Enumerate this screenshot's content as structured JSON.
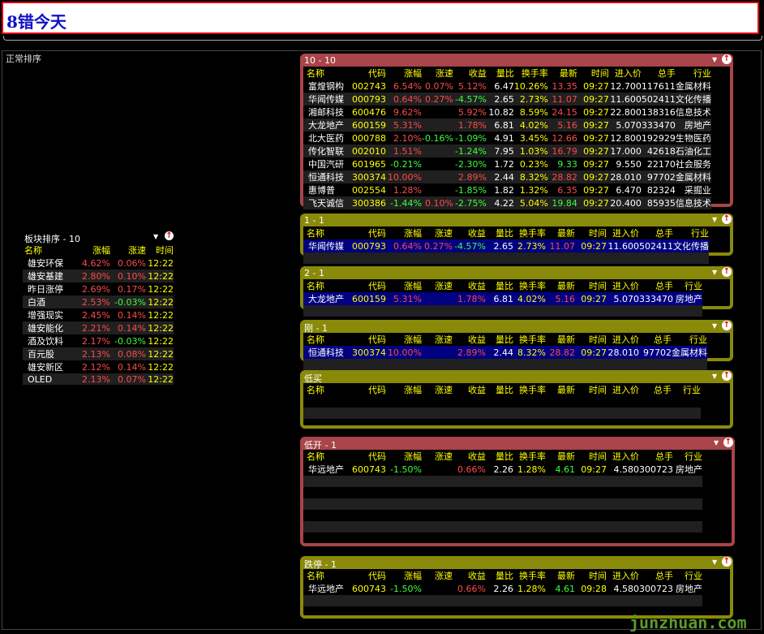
{
  "window_title": "8错今天",
  "main_label": "正常排序",
  "columns": [
    "名称",
    "代码",
    "涨幅",
    "涨速",
    "收益",
    "量比",
    "换手率",
    "最新",
    "时间",
    "进入价",
    "总手",
    "行业"
  ],
  "sector": {
    "title": "板块排序 - 10",
    "columns": [
      "名称",
      "涨幅",
      "涨速",
      "时间"
    ],
    "rows": [
      {
        "name": "雄安环保",
        "chg": "4.62%",
        "spd": "0.06%",
        "time": "12:22"
      },
      {
        "name": "雄安基建",
        "chg": "2.80%",
        "spd": "0.10%",
        "time": "12:22"
      },
      {
        "name": "昨日涨停",
        "chg": "2.69%",
        "spd": "0.17%",
        "time": "12:22"
      },
      {
        "name": "白酒",
        "chg": "2.53%",
        "spd": "-0.03%",
        "time": "12:22"
      },
      {
        "name": "增强现实",
        "chg": "2.45%",
        "spd": "0.14%",
        "time": "12:22"
      },
      {
        "name": "雄安能化",
        "chg": "2.21%",
        "spd": "0.14%",
        "time": "12:22"
      },
      {
        "name": "酒及饮料",
        "chg": "2.17%",
        "spd": "-0.03%",
        "time": "12:22"
      },
      {
        "name": "百元股",
        "chg": "2.13%",
        "spd": "0.08%",
        "time": "12:22"
      },
      {
        "name": "雄安新区",
        "chg": "2.12%",
        "spd": "0.14%",
        "time": "12:22"
      },
      {
        "name": "OLED",
        "chg": "2.13%",
        "spd": "0.07%",
        "time": "12:22"
      }
    ]
  },
  "windows": [
    {
      "title": "10 - 10",
      "color": "red",
      "rows": [
        [
          "富煌钢构",
          "002743",
          "6.54%",
          "0.07%",
          "5.12%",
          "6.47",
          "10.26%",
          "13.35",
          "09:27",
          "12.700",
          "117611",
          "金属材料"
        ],
        [
          "华闻传媒",
          "000793",
          "0.64%",
          "0.27%",
          "-4.57%",
          "2.65",
          "2.73%",
          "11.07",
          "09:27",
          "11.600",
          "502411",
          "文化传播"
        ],
        [
          "湘邮科技",
          "600476",
          "9.62%",
          "",
          "5.92%",
          "10.82",
          "8.59%",
          "24.15",
          "09:27",
          "22.800",
          "138316",
          "信息技术"
        ],
        [
          "大龙地产",
          "600159",
          "5.31%",
          "",
          "1.78%",
          "6.81",
          "4.02%",
          "5.16",
          "09:27",
          "5.070",
          "333470",
          "房地产"
        ],
        [
          "北大医药",
          "000788",
          "2.10%",
          "-0.16%",
          "-1.09%",
          "4.91",
          "3.45%",
          "12.66",
          "09:27",
          "12.800",
          "192929",
          "生物医药"
        ],
        [
          "传化智联",
          "002010",
          "1.51%",
          "",
          "-1.24%",
          "7.95",
          "1.03%",
          "16.79",
          "09:27",
          "17.000",
          "42618",
          "石油化工"
        ],
        [
          "中国汽研",
          "601965",
          "-0.21%",
          "",
          "-2.30%",
          "1.72",
          "0.23%",
          "9.33",
          "09:27",
          "9.550",
          "22170",
          "社会服务"
        ],
        [
          "恒通科技",
          "300374",
          "10.00%",
          "",
          "2.89%",
          "2.44",
          "8.32%",
          "28.82",
          "09:27",
          "28.010",
          "97702",
          "金属材料"
        ],
        [
          "惠博普",
          "002554",
          "1.28%",
          "",
          "-1.85%",
          "1.82",
          "1.32%",
          "6.35",
          "09:27",
          "6.470",
          "82324",
          "采掘业"
        ],
        [
          "飞天诚信",
          "300386",
          "-1.44%",
          "0.10%",
          "-2.75%",
          "4.22",
          "5.04%",
          "19.84",
          "09:27",
          "20.400",
          "85935",
          "信息技术"
        ]
      ]
    },
    {
      "title": "1 - 1",
      "color": "yel",
      "rows": [
        [
          "华闻传媒",
          "000793",
          "0.64%",
          "0.27%",
          "-4.57%",
          "2.65",
          "2.73%",
          "11.07",
          "09:27",
          "11.600",
          "502411",
          "文化传播"
        ]
      ]
    },
    {
      "title": "2 - 1",
      "color": "yel",
      "rows": [
        [
          "大龙地产",
          "600159",
          "5.31%",
          "",
          "1.78%",
          "6.81",
          "4.02%",
          "5.16",
          "09:27",
          "5.070",
          "333470",
          "房地产"
        ]
      ]
    },
    {
      "title": "刚 - 1",
      "color": "yel",
      "rows": [
        [
          "恒通科技",
          "300374",
          "10.00%",
          "",
          "2.89%",
          "2.44",
          "8.32%",
          "28.82",
          "09:27",
          "28.010",
          "97702",
          "金属材料"
        ]
      ]
    },
    {
      "title": "低买",
      "color": "yel",
      "rows": []
    },
    {
      "title": "低开 - 1",
      "color": "red",
      "rows": [
        [
          "华远地产",
          "600743",
          "-1.50%",
          "",
          "0.66%",
          "2.26",
          "1.28%",
          "4.61",
          "09:27",
          "4.580",
          "300723",
          "房地产"
        ]
      ]
    },
    {
      "title": "跌停 - 1",
      "color": "yel",
      "rows": [
        [
          "华远地产",
          "600743",
          "-1.50%",
          "",
          "0.66%",
          "2.26",
          "1.28%",
          "4.61",
          "09:28",
          "4.580",
          "300723",
          "房地产"
        ]
      ]
    }
  ],
  "watermark": "junzhuan.com"
}
